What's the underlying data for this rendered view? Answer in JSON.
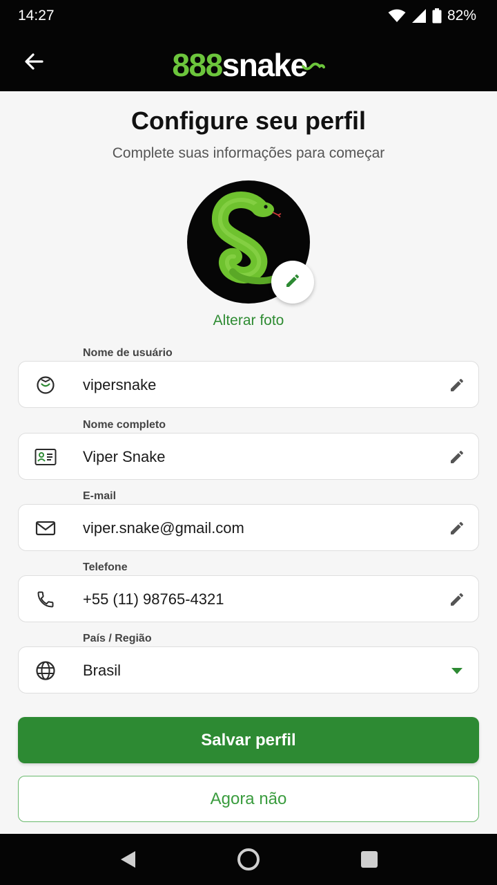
{
  "status_bar": {
    "time": "14:27",
    "battery": "82%",
    "icons": [
      "wifi-icon",
      "signal-icon",
      "battery-icon"
    ]
  },
  "header": {
    "back_icon": "arrow-left-icon",
    "logo_number": "888",
    "logo_word": "snake"
  },
  "main": {
    "title": "Configure seu perfil",
    "subtitle": "Complete suas informações para começar",
    "change_photo": "Alterar foto"
  },
  "fields": {
    "username": {
      "label": "Nome de usuário",
      "value": "vipersnake",
      "icon": "user-circle-icon"
    },
    "fullname": {
      "label": "Nome completo",
      "value": "Viper Snake",
      "icon": "id-card-icon"
    },
    "email": {
      "label": "E-mail",
      "value": "viper.snake@gmail.com",
      "icon": "mail-icon"
    },
    "phone": {
      "label": "Telefone",
      "value": "+55 (11) 98765-4321",
      "icon": "phone-icon"
    },
    "country": {
      "label": "País / Região",
      "value": "Brasil",
      "icon": "globe-icon"
    }
  },
  "buttons": {
    "save": "Salvar perfil",
    "skip": "Agora não"
  },
  "colors": {
    "brand_green": "#2d8a33",
    "logo_green": "#6cc53c",
    "dark_bg": "#050505"
  }
}
